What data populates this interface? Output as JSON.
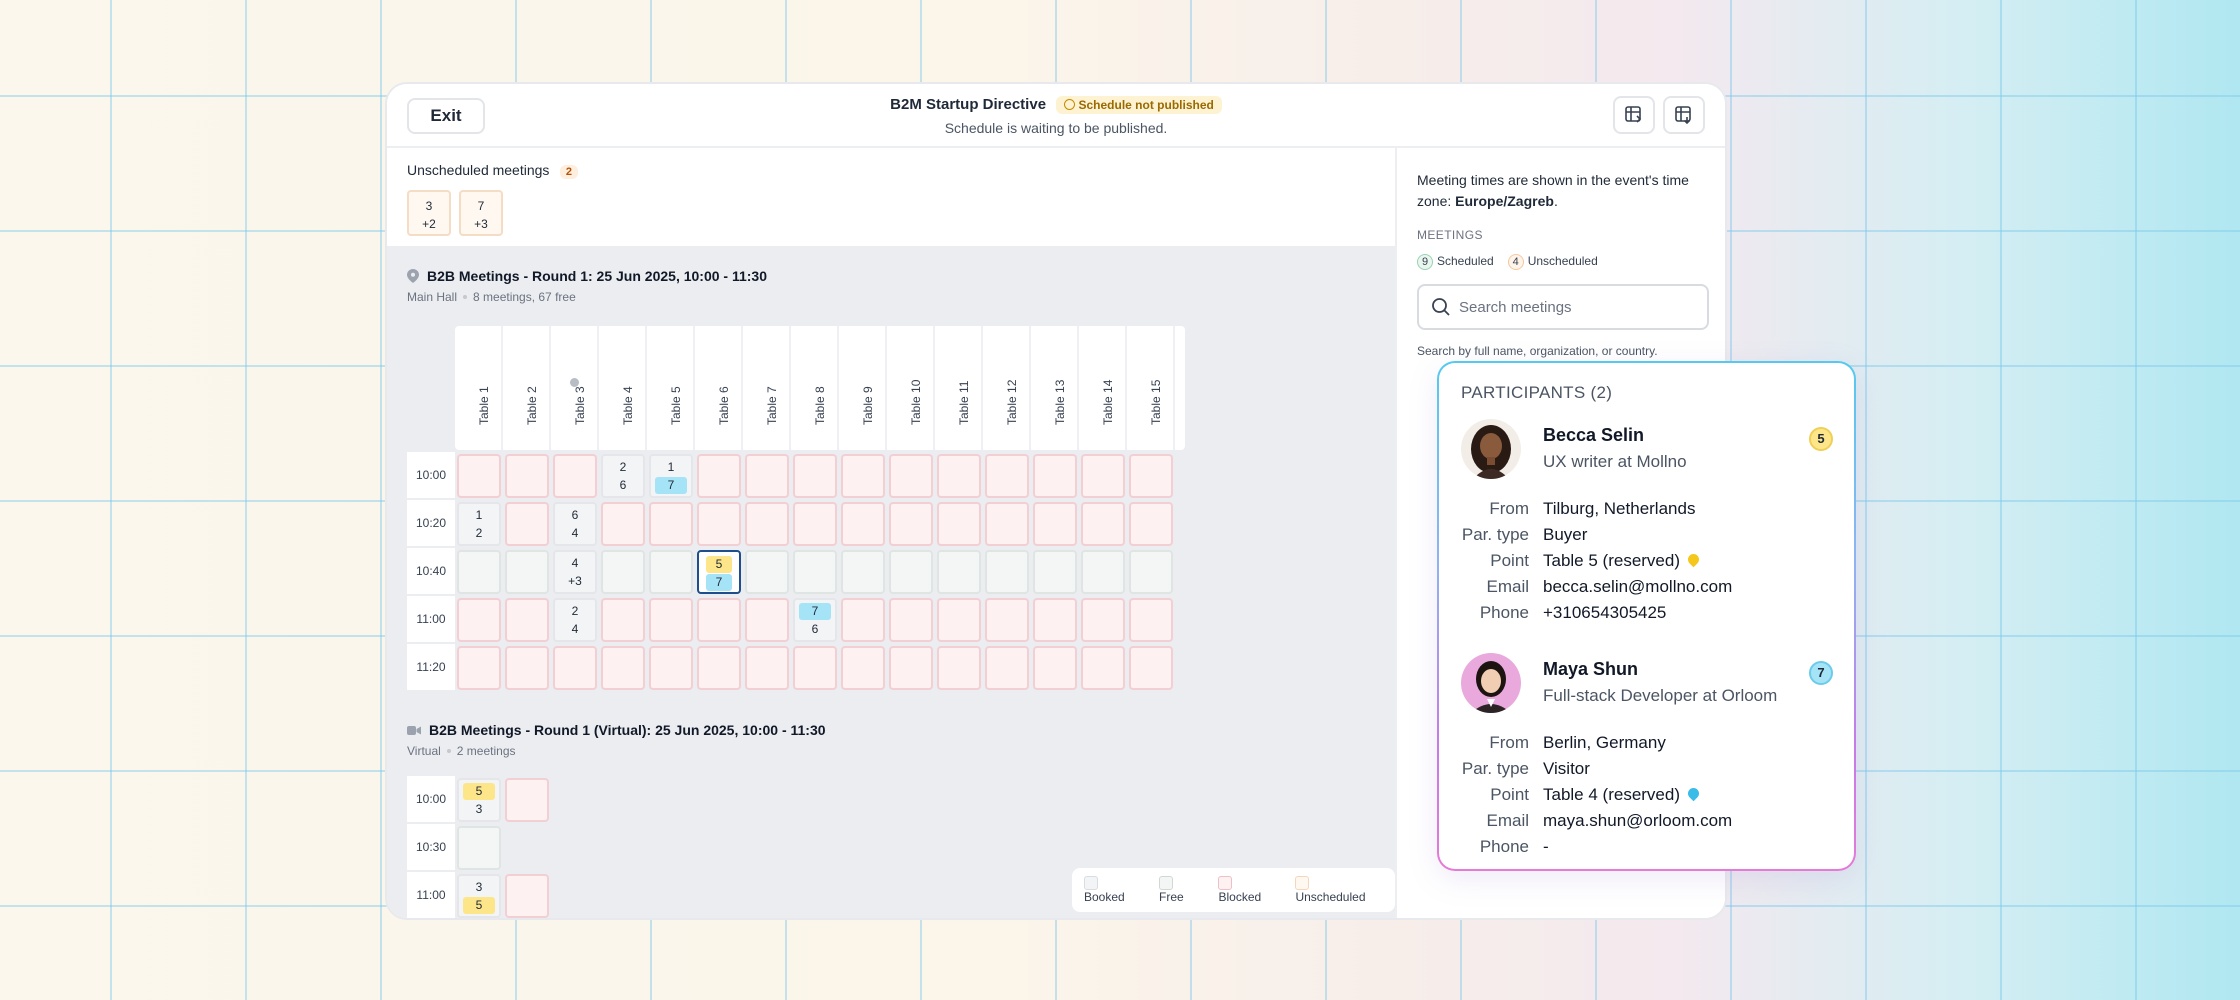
{
  "header": {
    "exit_label": "Exit",
    "title": "B2M Startup Directive",
    "status_badge": "Schedule not published",
    "subtitle": "Schedule is waiting to be published."
  },
  "unscheduled": {
    "title": "Unscheduled meetings",
    "count": "2",
    "cards": [
      {
        "top": "3",
        "bottom": "+2"
      },
      {
        "top": "7",
        "bottom": "+3"
      }
    ]
  },
  "round1": {
    "title": "B2B Meetings - Round 1: 25 Jun 2025, 10:00 - 11:30",
    "location": "Main Hall",
    "info": "8 meetings, 67 free",
    "columns": [
      "Table 1",
      "Table 2",
      "Table 3",
      "Table 4",
      "Table 5",
      "Table 6",
      "Table 7",
      "Table 8",
      "Table 9",
      "Table 10",
      "Table 11",
      "Table 12",
      "Table 13",
      "Table 14",
      "Table 15"
    ],
    "times": [
      "10:00",
      "10:20",
      "10:40",
      "11:00",
      "11:20"
    ],
    "booked": [
      {
        "row": 0,
        "col": 3,
        "a": "2",
        "b": "6",
        "ac": "plain",
        "bc": "plain"
      },
      {
        "row": 0,
        "col": 4,
        "a": "1",
        "b": "7",
        "ac": "plain",
        "bc": "blue"
      },
      {
        "row": 1,
        "col": 0,
        "a": "1",
        "b": "2",
        "ac": "plain",
        "bc": "plain"
      },
      {
        "row": 1,
        "col": 2,
        "a": "6",
        "b": "4",
        "ac": "plain",
        "bc": "plain"
      },
      {
        "row": 2,
        "col": 2,
        "a": "4",
        "b": "+3",
        "ac": "plain",
        "bc": "plain"
      },
      {
        "row": 2,
        "col": 5,
        "a": "5",
        "b": "7",
        "ac": "yellow",
        "bc": "blue",
        "selected": true
      },
      {
        "row": 3,
        "col": 2,
        "a": "2",
        "b": "4",
        "ac": "plain",
        "bc": "plain"
      },
      {
        "row": 3,
        "col": 7,
        "a": "7",
        "b": "6",
        "ac": "blue",
        "bc": "plain"
      }
    ]
  },
  "round1_virtual": {
    "title": "B2B Meetings - Round 1 (Virtual): 25 Jun 2025, 10:00 - 11:30",
    "location": "Virtual",
    "info": "2 meetings",
    "times": [
      "10:00",
      "10:30",
      "11:00"
    ],
    "slots": [
      {
        "a": "5",
        "b": "3",
        "ac": "yellow",
        "bc": "plain"
      },
      {
        "free": true
      },
      {
        "a": "3",
        "b": "5",
        "ac": "plain",
        "bc": "yellow"
      }
    ]
  },
  "legend": {
    "booked": "Booked",
    "free": "Free",
    "blocked": "Blocked",
    "unscheduled": "Unscheduled"
  },
  "side": {
    "tz_text": "Meeting times are shown in the event's time zone: ",
    "tz_value": "Europe/Zagreb",
    "tz_end": ".",
    "meetings_label": "MEETINGS",
    "scheduled_count": "9",
    "scheduled_label": "Scheduled",
    "unscheduled_count": "4",
    "unscheduled_label": "Unscheduled",
    "search_placeholder": "Search meetings",
    "search_hint": "Search by full name, organization, or country."
  },
  "participants": {
    "title": "PARTICIPANTS (2)",
    "labels": {
      "from": "From",
      "type": "Par. type",
      "point": "Point",
      "email": "Email",
      "phone": "Phone"
    },
    "list": [
      {
        "name": "Becca Selin",
        "role": "UX writer at Mollno",
        "badge": "5",
        "from": "Tilburg, Netherlands",
        "type": "Buyer",
        "point": "Table 5 (reserved)",
        "email": "becca.selin@mollno.com",
        "phone": "+310654305425"
      },
      {
        "name": "Maya Shun",
        "role": "Full-stack Developer at Orloom",
        "badge": "7",
        "from": "Berlin, Germany",
        "type": "Visitor",
        "point": "Table 4 (reserved)",
        "email": "maya.shun@orloom.com",
        "phone": "-"
      }
    ]
  },
  "colors": {
    "yellow_chip": "#fde68a",
    "blue_chip": "#a5e3f7",
    "selected_border": "#1e4f8c"
  }
}
